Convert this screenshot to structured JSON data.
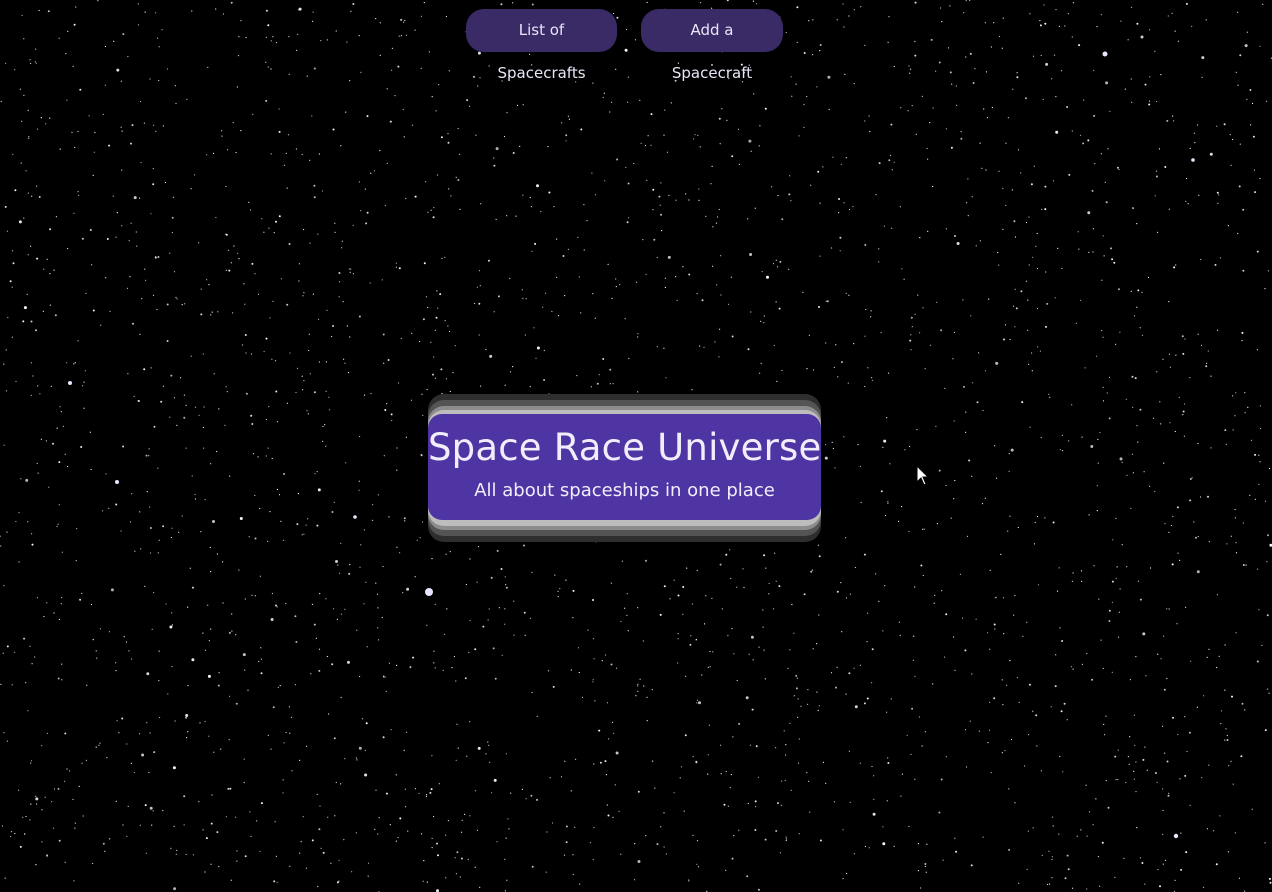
{
  "nav": {
    "list_label": "List of Spacecrafts",
    "add_label": "Add a Spacecraft"
  },
  "hero": {
    "title": "Space Race Universe",
    "subtitle": "All about spaceships in one place"
  },
  "colors": {
    "background": "#000000",
    "nav_button": "#3a2a66",
    "hero_panel": "#4f35a3",
    "text": "#f1edfb"
  },
  "icons": {
    "cursor": "mouse-pointer-icon"
  }
}
